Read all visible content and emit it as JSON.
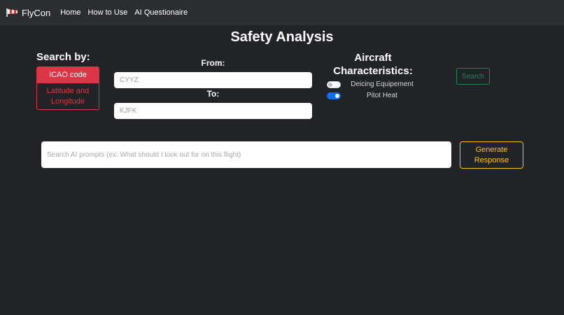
{
  "navbar": {
    "brand": "FlyCon",
    "brand_icon": "windsock-icon",
    "links": [
      "Home",
      "How to Use",
      "AI Questionaire"
    ]
  },
  "title": "Safety Analysis",
  "search_by": {
    "label": "Search by:",
    "options": [
      "ICAO code",
      "Latitude and Longitude"
    ],
    "selected": "ICAO code"
  },
  "route": {
    "from_label": "From:",
    "from_placeholder": "CYYZ",
    "to_label": "To:",
    "to_placeholder": "KJFK"
  },
  "aircraft": {
    "title": "Aircraft Characteristics:",
    "toggles": [
      {
        "label": "Deicing Equipement",
        "on": false
      },
      {
        "label": "Pitot Heat",
        "on": true
      }
    ]
  },
  "search_button": "Search",
  "ai": {
    "placeholder": "Search AI prompts (ex: What should I look out for on this flight)",
    "generate_label": "Generate Response"
  },
  "colors": {
    "background": "#212326",
    "navbar": "#2b2d31",
    "danger": "#dc3545",
    "success": "#198754",
    "warning": "#ffc107",
    "toggle_on": "#0d6efd"
  }
}
